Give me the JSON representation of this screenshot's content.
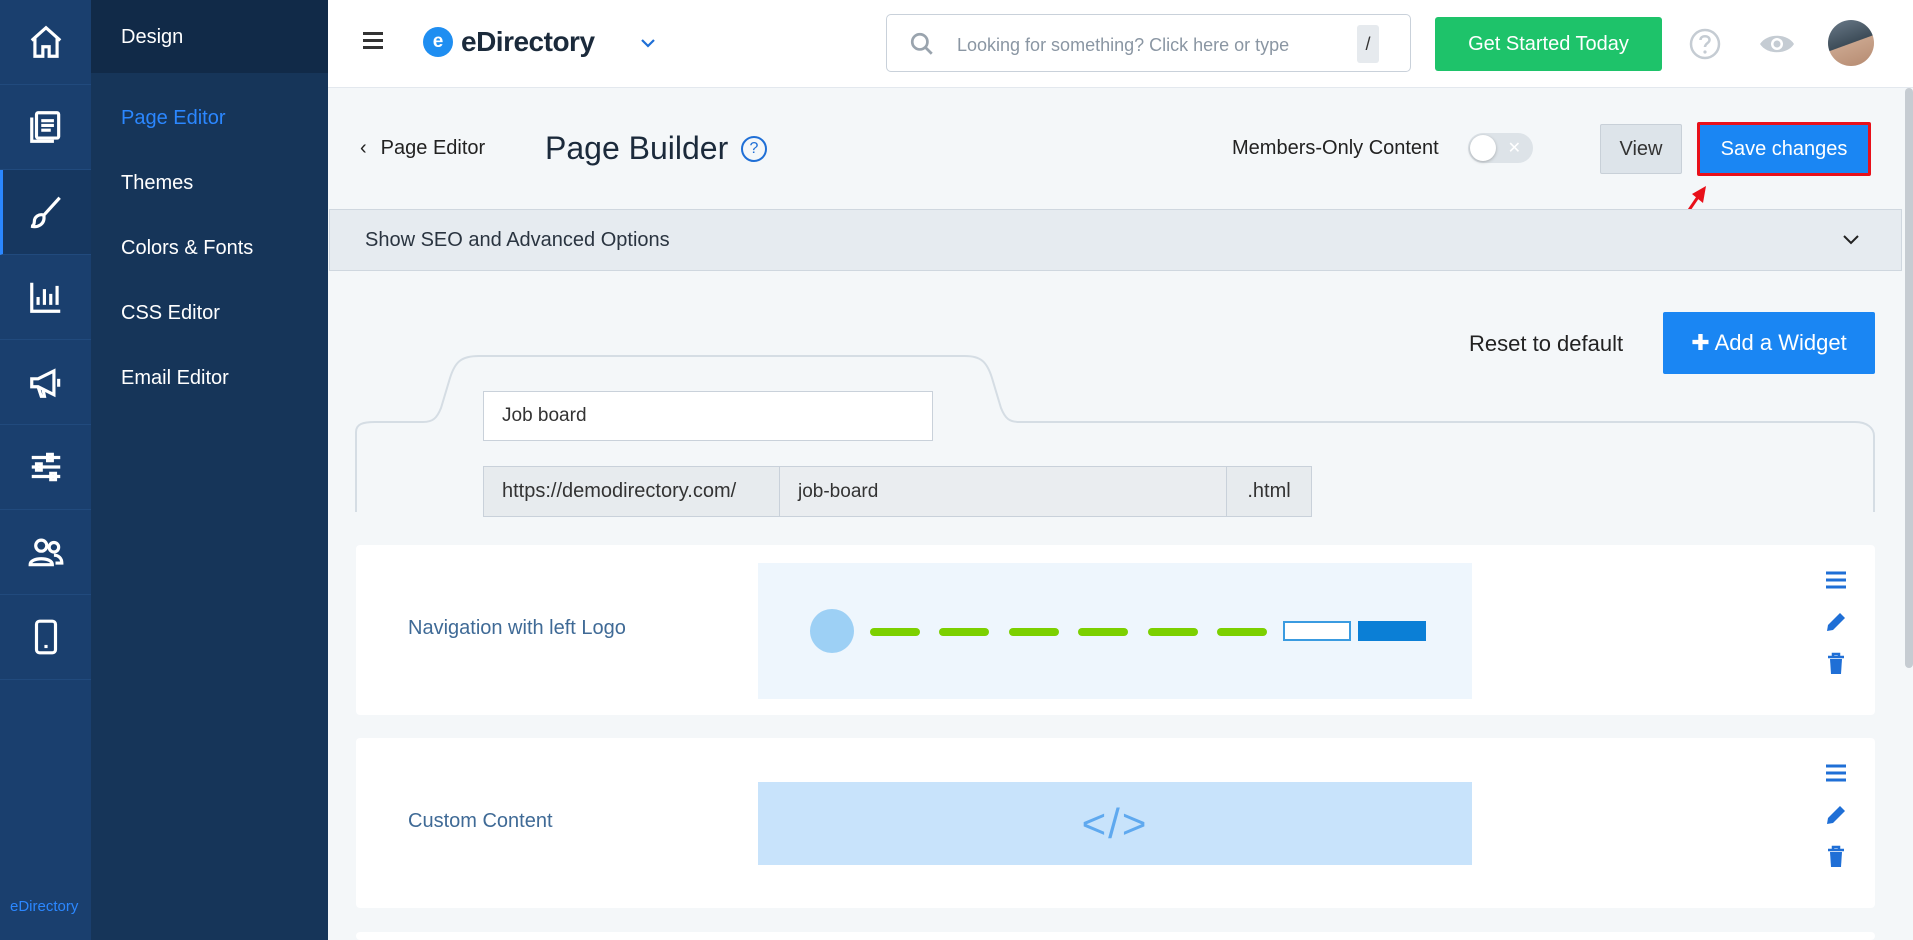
{
  "rail": {
    "items": [
      {
        "icon": "home-icon"
      },
      {
        "icon": "pages-icon"
      },
      {
        "icon": "brush-icon",
        "active": true
      },
      {
        "icon": "chart-icon"
      },
      {
        "icon": "megaphone-icon"
      },
      {
        "icon": "sliders-icon"
      },
      {
        "icon": "users-icon"
      },
      {
        "icon": "mobile-icon"
      }
    ],
    "brand": "eDirectory"
  },
  "subnav": {
    "title": "Design",
    "items": [
      {
        "label": "Page Editor",
        "active": true
      },
      {
        "label": "Themes"
      },
      {
        "label": "Colors & Fonts"
      },
      {
        "label": "CSS Editor"
      },
      {
        "label": "Email Editor"
      }
    ]
  },
  "topbar": {
    "logo_letter": "e",
    "logo_text": "eDirectory",
    "search_placeholder": "Looking for something? Click here or type",
    "search_shortcut": "/",
    "cta": "Get Started Today"
  },
  "header": {
    "back_label": "Page Editor",
    "title": "Page Builder",
    "help": "?",
    "members_label": "Members-Only Content",
    "members_toggle_on": false,
    "view_label": "View",
    "save_label": "Save changes"
  },
  "seo": {
    "label": "Show SEO and Advanced Options"
  },
  "actions": {
    "reset": "Reset to default",
    "add_widget": "Add a Widget",
    "add_prefix": "✚"
  },
  "page": {
    "name": "Job board",
    "url_prefix": "https://demodirectory.com/",
    "url_slug": "job-board",
    "url_suffix": ".html"
  },
  "widgets": [
    {
      "label": "Navigation with left Logo"
    },
    {
      "label": "Custom Content",
      "preview_text": "</>"
    }
  ],
  "colors": {
    "primary": "#1a86f3",
    "green": "#1ec36a",
    "highlight": "#e8101a",
    "rail": "#1a3f6e",
    "subnav": "#163559"
  }
}
